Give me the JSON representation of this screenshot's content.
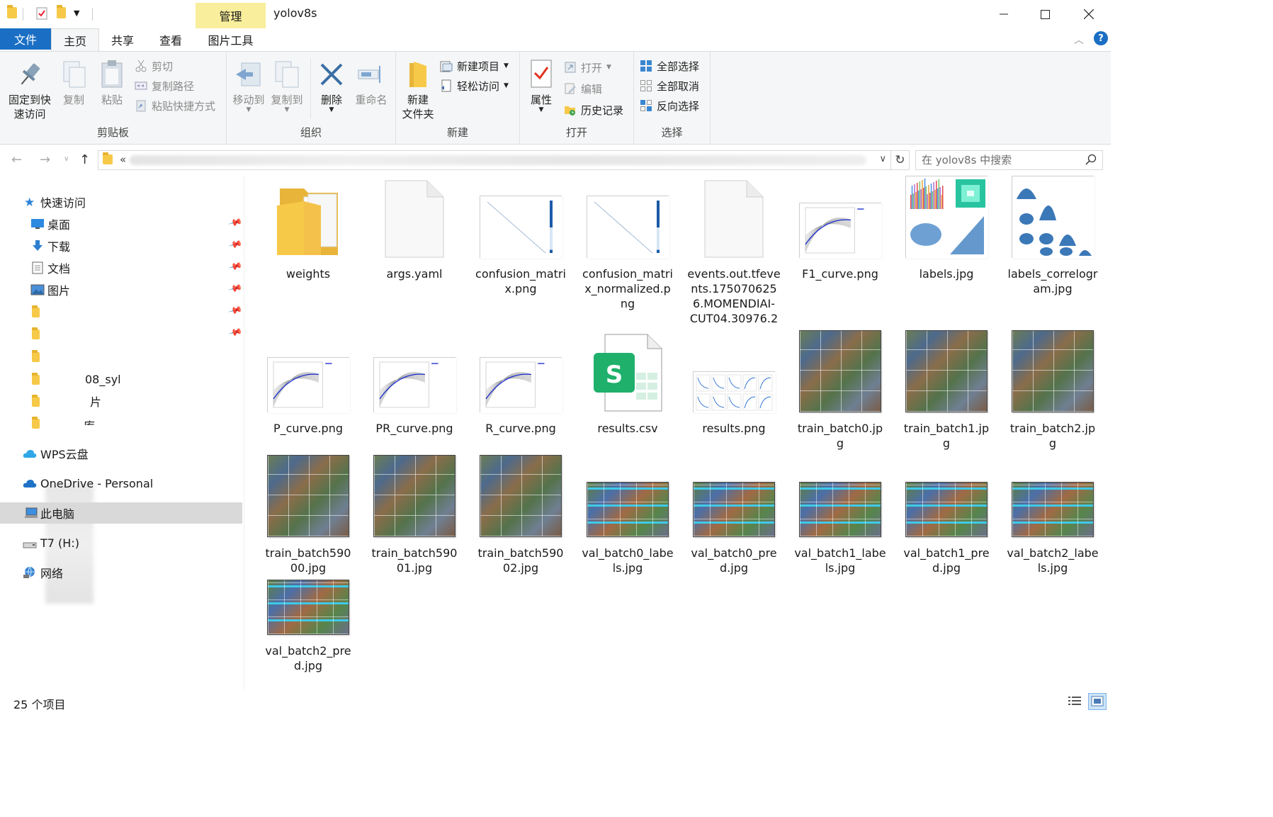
{
  "window": {
    "title": "yolov8s",
    "context_tab": "管理",
    "controls": [
      "minimize",
      "maximize",
      "close"
    ]
  },
  "ribbon_tabs": {
    "file": "文件",
    "home": "主页",
    "share": "共享",
    "view": "查看",
    "picture_tools": "图片工具"
  },
  "ribbon": {
    "clipboard": {
      "label": "剪贴板",
      "pin": "固定到快\n速访问",
      "copy": "复制",
      "paste": "粘贴",
      "cut": "剪切",
      "copy_path": "复制路径",
      "paste_shortcut": "粘贴快捷方式"
    },
    "organize": {
      "label": "组织",
      "move_to": "移动到",
      "copy_to": "复制到",
      "delete": "删除",
      "rename": "重命名"
    },
    "new": {
      "label": "新建",
      "new_folder": "新建\n文件夹",
      "new_item": "新建项目",
      "easy_access": "轻松访问"
    },
    "open": {
      "label": "打开",
      "properties": "属性",
      "open": "打开",
      "edit": "编辑",
      "history": "历史记录"
    },
    "select": {
      "label": "选择",
      "select_all": "全部选择",
      "select_none": "全部取消",
      "invert": "反向选择"
    }
  },
  "address": {
    "chevron": "«",
    "search_placeholder": "在 yolov8s 中搜索"
  },
  "nav": {
    "quick_access": "快速访问",
    "desktop": "桌面",
    "downloads": "下载",
    "documents": "文档",
    "pictures": "图片",
    "partial_1": "08_syl",
    "partial_2": "片",
    "partial_3": "库",
    "wps": "WPS云盘",
    "onedrive": "OneDrive - Personal",
    "this_pc": "此电脑",
    "t7": "T7 (H:)",
    "network": "网络"
  },
  "files": [
    {
      "name": "weights",
      "kind": "folder"
    },
    {
      "name": "args.yaml",
      "kind": "doc"
    },
    {
      "name": "confusion_matrix.png",
      "kind": "matrix"
    },
    {
      "name": "confusion_matrix_normalized.png",
      "kind": "matrix"
    },
    {
      "name": "events.out.tfevents.1750706256.MOMENDIAI-CUT04.30976.2",
      "kind": "doc"
    },
    {
      "name": "F1_curve.png",
      "kind": "curve"
    },
    {
      "name": "labels.jpg",
      "kind": "labels"
    },
    {
      "name": "labels_correlogram.jpg",
      "kind": "correlogram"
    },
    {
      "name": "P_curve.png",
      "kind": "curve"
    },
    {
      "name": "PR_curve.png",
      "kind": "curve"
    },
    {
      "name": "R_curve.png",
      "kind": "curve"
    },
    {
      "name": "results.csv",
      "kind": "csv"
    },
    {
      "name": "results.png",
      "kind": "results"
    },
    {
      "name": "train_batch0.jpg",
      "kind": "mosaic"
    },
    {
      "name": "train_batch1.jpg",
      "kind": "mosaic"
    },
    {
      "name": "train_batch2.jpg",
      "kind": "mosaic"
    },
    {
      "name": "train_batch59000.jpg",
      "kind": "mosaic"
    },
    {
      "name": "train_batch59001.jpg",
      "kind": "mosaic"
    },
    {
      "name": "train_batch59002.jpg",
      "kind": "mosaic"
    },
    {
      "name": "val_batch0_labels.jpg",
      "kind": "val"
    },
    {
      "name": "val_batch0_pred.jpg",
      "kind": "val"
    },
    {
      "name": "val_batch1_labels.jpg",
      "kind": "val"
    },
    {
      "name": "val_batch1_pred.jpg",
      "kind": "val"
    },
    {
      "name": "val_batch2_labels.jpg",
      "kind": "val"
    },
    {
      "name": "val_batch2_pred.jpg",
      "kind": "val"
    }
  ],
  "file_labels": [
    [
      "weights"
    ],
    [
      "args.yaml"
    ],
    [
      "confusion_matri",
      "x.png"
    ],
    [
      "confusion_matri",
      "x_normalized.p",
      "ng"
    ],
    [
      "events.out.tfeve",
      "nts.175070625",
      "6.MOMENDIAI-",
      "CUT04.30976.2"
    ],
    [
      "F1_curve.png"
    ],
    [
      "labels.jpg"
    ],
    [
      "labels_correlogr",
      "am.jpg"
    ],
    [
      "P_curve.png"
    ],
    [
      "PR_curve.png"
    ],
    [
      "R_curve.png"
    ],
    [
      "results.csv"
    ],
    [
      "results.png"
    ],
    [
      "train_batch0.jp",
      "g"
    ],
    [
      "train_batch1.jp",
      "g"
    ],
    [
      "train_batch2.jp",
      "g"
    ],
    [
      "train_batch590",
      "00.jpg"
    ],
    [
      "train_batch590",
      "01.jpg"
    ],
    [
      "train_batch590",
      "02.jpg"
    ],
    [
      "val_batch0_labe",
      "ls.jpg"
    ],
    [
      "val_batch0_pre",
      "d.jpg"
    ],
    [
      "val_batch1_labe",
      "ls.jpg"
    ],
    [
      "val_batch1_pre",
      "d.jpg"
    ],
    [
      "val_batch2_labe",
      "ls.jpg"
    ],
    [
      "val_batch2_pre",
      "d.jpg"
    ]
  ],
  "status": {
    "count": "25 个项目"
  },
  "colors": {
    "accent": "#1a6fc4",
    "manage_tab": "#f8ee9b",
    "folder": "#f7c948",
    "selected_nav": "#d9d9d9"
  }
}
